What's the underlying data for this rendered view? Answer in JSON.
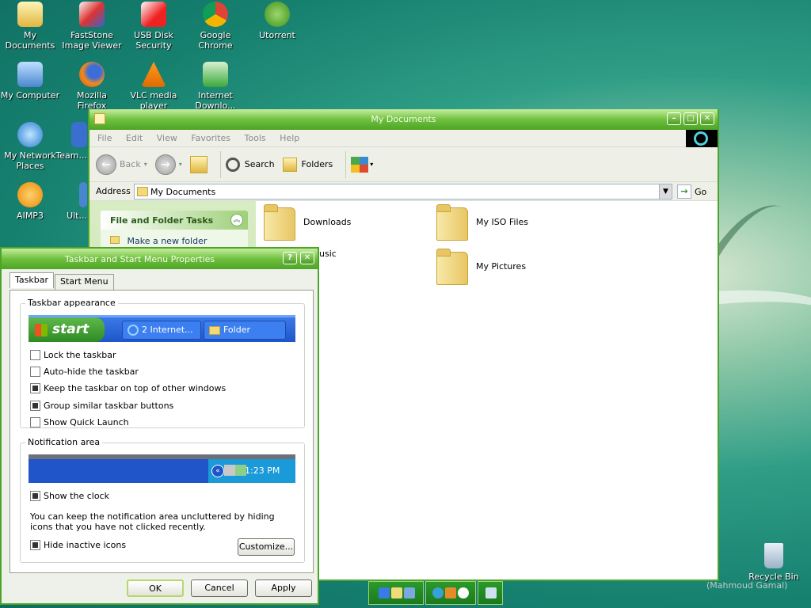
{
  "desktop": {
    "icons": [
      {
        "label": "My Documents"
      },
      {
        "label": "FastStone Image Viewer"
      },
      {
        "label": "USB Disk Security"
      },
      {
        "label": "Google Chrome"
      },
      {
        "label": "Utorrent"
      },
      {
        "label": "My Computer"
      },
      {
        "label": "Mozilla Firefox"
      },
      {
        "label": "VLC media player"
      },
      {
        "label": "Internet Downlo..."
      },
      {
        "label": "My Network Places"
      },
      {
        "label": "Team..."
      },
      {
        "label": "AIMP3"
      },
      {
        "label": "Ult..."
      },
      {
        "label": "Recycle Bin"
      }
    ],
    "watermark": "(Mahmoud Gamal)"
  },
  "explorer": {
    "title": "My Documents",
    "menu": [
      "File",
      "Edit",
      "View",
      "Favorites",
      "Tools",
      "Help"
    ],
    "toolbar": {
      "back": "Back",
      "search": "Search",
      "folders": "Folders"
    },
    "address_label": "Address",
    "address_value": "My Documents",
    "go": "Go",
    "task_pane": {
      "header": "File and Folder Tasks",
      "item": "Make a new folder"
    },
    "files": [
      {
        "name": "Downloads"
      },
      {
        "name": "My ISO Files"
      },
      {
        "name": "usic"
      },
      {
        "name": "My Pictures"
      }
    ]
  },
  "dialog": {
    "title": "Taskbar and Start Menu Properties",
    "help": "?",
    "close": "✕",
    "tabs": [
      "Taskbar",
      "Start Menu"
    ],
    "appearance_group": "Taskbar appearance",
    "preview": {
      "start": "start",
      "ie_button": "2 Internet...",
      "folder_button": "Folder"
    },
    "options": [
      {
        "label": "Lock the taskbar",
        "checked": false
      },
      {
        "label": "Auto-hide the taskbar",
        "checked": false
      },
      {
        "label": "Keep the taskbar on top of other windows",
        "checked": true
      },
      {
        "label": "Group similar taskbar buttons",
        "checked": true
      },
      {
        "label": "Show Quick Launch",
        "checked": false
      }
    ],
    "notification_group": "Notification area",
    "clock": "1:23 PM",
    "show_clock": {
      "label": "Show the clock",
      "checked": true
    },
    "note": "You can keep the notification area uncluttered by hiding icons that you have not clicked recently.",
    "hide_inactive": {
      "label": "Hide inactive icons",
      "checked": true
    },
    "customize": "Customize...",
    "ok": "OK",
    "cancel": "Cancel",
    "apply": "Apply"
  }
}
